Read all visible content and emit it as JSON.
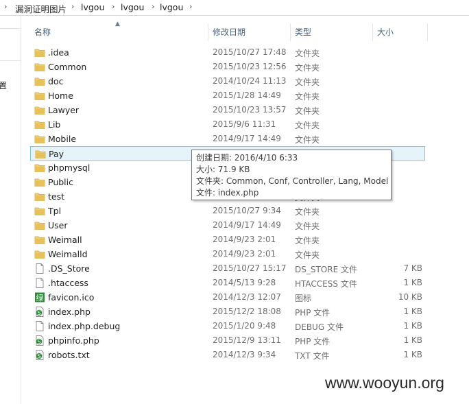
{
  "breadcrumb": [
    "漏洞证明图片",
    "lvgou",
    "lvgou",
    "lvgou"
  ],
  "nav": {
    "label": "置"
  },
  "columns": {
    "name": "名称",
    "date": "修改日期",
    "type": "类型",
    "size": "大小"
  },
  "rows": [
    {
      "name": ".idea",
      "date": "2015/10/27 17:48",
      "type": "文件夹",
      "size": "",
      "icon": "folder-icon"
    },
    {
      "name": "Common",
      "date": "2015/10/23 12:56",
      "type": "文件夹",
      "size": "",
      "icon": "folder-icon"
    },
    {
      "name": "doc",
      "date": "2014/10/24 11:13",
      "type": "文件夹",
      "size": "",
      "icon": "folder-icon"
    },
    {
      "name": "Home",
      "date": "2015/1/28 14:49",
      "type": "文件夹",
      "size": "",
      "icon": "folder-icon"
    },
    {
      "name": "Lawyer",
      "date": "2015/10/23 13:57",
      "type": "文件夹",
      "size": "",
      "icon": "folder-icon"
    },
    {
      "name": "Lib",
      "date": "2015/9/6 11:31",
      "type": "文件夹",
      "size": "",
      "icon": "folder-icon"
    },
    {
      "name": "Mobile",
      "date": "2014/9/17 14:49",
      "type": "文件夹",
      "size": "",
      "icon": "folder-icon"
    },
    {
      "name": "Pay",
      "date": "",
      "type": "",
      "size": "",
      "icon": "folder-icon"
    },
    {
      "name": "phpmysql",
      "date": "",
      "type": "",
      "size": "",
      "icon": "folder-icon"
    },
    {
      "name": "Public",
      "date": "",
      "type": "",
      "size": "",
      "icon": "folder-icon"
    },
    {
      "name": "test",
      "date": "",
      "type": "文件夹",
      "size": "",
      "icon": "folder-icon"
    },
    {
      "name": "Tpl",
      "date": "2015/10/27 9:34",
      "type": "文件夹",
      "size": "",
      "icon": "folder-icon"
    },
    {
      "name": "User",
      "date": "2014/9/17 14:49",
      "type": "文件夹",
      "size": "",
      "icon": "folder-icon"
    },
    {
      "name": "Weimall",
      "date": "2014/9/23 2:01",
      "type": "文件夹",
      "size": "",
      "icon": "folder-icon"
    },
    {
      "name": "Weimalld",
      "date": "2014/9/23 2:01",
      "type": "文件夹",
      "size": "",
      "icon": "folder-icon"
    },
    {
      "name": ".DS_Store",
      "date": "2015/10/27 15:17",
      "type": "DS_STORE 文件",
      "size": "7 KB",
      "icon": "file-icon"
    },
    {
      "name": ".htaccess",
      "date": "2014/5/13 9:28",
      "type": "HTACCESS 文件",
      "size": "1 KB",
      "icon": "file-icon"
    },
    {
      "name": "favicon.ico",
      "date": "2014/12/3 12:07",
      "type": "图标",
      "size": "10 KB",
      "icon": "ico-file-icon"
    },
    {
      "name": "index.php",
      "date": "2015/12/2 18:08",
      "type": "PHP 文件",
      "size": "1 KB",
      "icon": "php-file-icon"
    },
    {
      "name": "index.php.debug",
      "date": "2015/1/20 9:48",
      "type": "DEBUG 文件",
      "size": "1 KB",
      "icon": "file-icon"
    },
    {
      "name": "phpinfo.php",
      "date": "2015/12/9 13:11",
      "type": "PHP 文件",
      "size": "1 KB",
      "icon": "php-file-icon"
    },
    {
      "name": "robots.txt",
      "date": "2014/12/3 9:34",
      "type": "TXT 文件",
      "size": "1 KB",
      "icon": "php-file-icon"
    }
  ],
  "selected_index": 7,
  "tooltip": {
    "created": "创建日期: 2016/4/10 6:33",
    "size": "大小: 71.9 KB",
    "folders": "文件夹: Common, Conf, Controller, Lang, Model",
    "files": "文件: index.php"
  },
  "watermark": "www.wooyun.org",
  "colors": {
    "folder": "#e8c158",
    "selection_bg": "#e5f3fb",
    "selection_border": "#7ec1e9",
    "php_icon": "#2e8b3a"
  }
}
